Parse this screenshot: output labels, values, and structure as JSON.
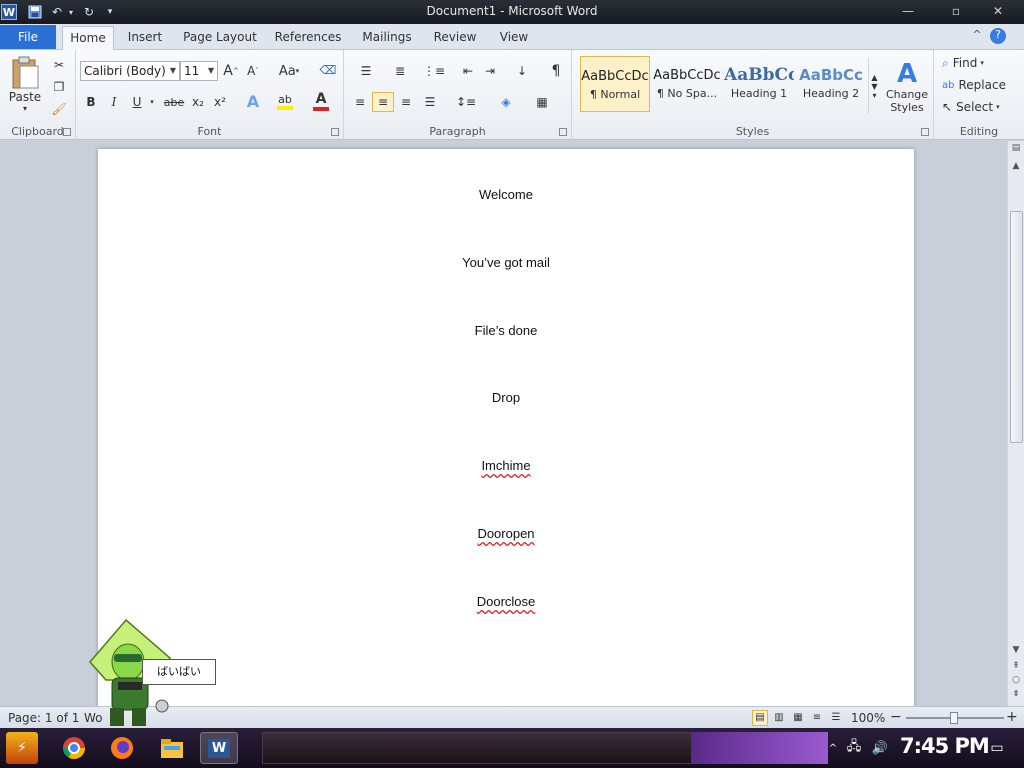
{
  "window": {
    "title": "Document1 - Microsoft Word",
    "app_icon_letter": "W"
  },
  "tabs": {
    "file": "File",
    "items": [
      "Home",
      "Insert",
      "Page Layout",
      "References",
      "Mailings",
      "Review",
      "View"
    ],
    "active": "Home"
  },
  "ribbon": {
    "clipboard": {
      "label": "Clipboard",
      "paste": "Paste"
    },
    "font": {
      "label": "Font",
      "name": "Calibri (Body)",
      "size": "11",
      "grow": "A",
      "shrink": "A",
      "case": "Aa",
      "bold": "B",
      "italic": "I",
      "underline": "U",
      "strike": "abe",
      "subscript": "x₂",
      "superscript": "x²"
    },
    "paragraph": {
      "label": "Paragraph",
      "pilcrow": "¶"
    },
    "styles": {
      "label": "Styles",
      "items": [
        {
          "sample": "AaBbCcDc",
          "name": "¶ Normal"
        },
        {
          "sample": "AaBbCcDc",
          "name": "¶ No Spa..."
        },
        {
          "sample": "AaBbCc",
          "name": "Heading 1"
        },
        {
          "sample": "AaBbCc",
          "name": "Heading 2"
        }
      ],
      "change_styles": [
        "Change",
        "Styles"
      ]
    },
    "editing": {
      "label": "Editing",
      "find": "Find",
      "replace": "Replace",
      "select": "Select"
    }
  },
  "document": {
    "paragraphs": [
      {
        "text": "Welcome",
        "misspelled": false
      },
      {
        "text": "You’ve got mail",
        "misspelled": false
      },
      {
        "text": "File’s done",
        "misspelled": false
      },
      {
        "text": "Drop",
        "misspelled": false
      },
      {
        "text": "Imchime",
        "misspelled": true
      },
      {
        "text": "Dooropen",
        "misspelled": true
      },
      {
        "text": "Doorclose",
        "misspelled": true
      }
    ]
  },
  "statusbar": {
    "page": "Page: 1 of 1",
    "words": "Wo",
    "zoom": "100%",
    "zoom_minus": "−",
    "zoom_plus": "+",
    "zoom_level": 0.5
  },
  "mascot": {
    "speech": "ばいばい"
  },
  "taskbar": {
    "clock": "7:45 PM"
  },
  "colors": {
    "file_tab": "#2a6fd3",
    "selected_style": "#fdf1c9",
    "font_color_bar": "#e0201f",
    "highlight_bar": "#ffee00",
    "heading_blue": "#3d6aa6"
  }
}
